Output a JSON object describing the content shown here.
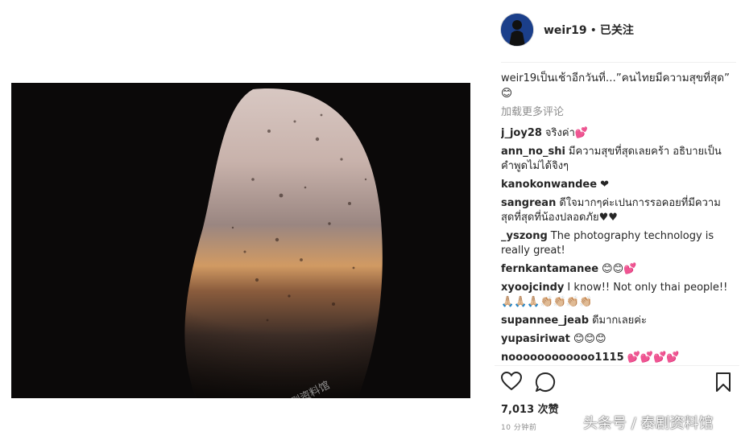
{
  "post": {
    "header": {
      "username": "weir19",
      "separator": "•",
      "follow_status": "已关注"
    },
    "caption": {
      "username": "weir19",
      "text": "เป็นเช้าอีกวันที่...”คนไทยมีความสุขที่สุด” 😊"
    },
    "load_more_label": "加载更多评论",
    "comments": [
      {
        "user": "j_joy28",
        "text": "จริงค่า💕"
      },
      {
        "user": "ann_no_shi",
        "text": "มีความสุขที่สุดเลยคร้า อธิบายเป็นคำพูดไม่ได้จิงๆ"
      },
      {
        "user": "kanokonwandee",
        "text": "❤"
      },
      {
        "user": "sangrean",
        "text": "ดีใจมากๆค่ะเปนการรอคอยที่มีความสุดที่สุดที่น้องปลอดภัย♥♥"
      },
      {
        "user": "_yszong",
        "text": "The photography technology is really great!"
      },
      {
        "user": "fernkantamanee",
        "text": "😊😊💕"
      },
      {
        "user": "xyoojcindy",
        "text": "I know!! Not only thai people!! 🙏🏼🙏🏼🙏🏼👏🏼👏🏼👏🏼👏🏼"
      },
      {
        "user": "supannee_jeab",
        "text": "ดีมากเลยค่ะ"
      },
      {
        "user": "yupasiriwat",
        "text": "😊😊😊"
      },
      {
        "user": "noooooooooooo1115",
        "text": "💕💕💕💕"
      }
    ],
    "likes": "7,013 次赞",
    "time": "10 分钟前",
    "icons": {
      "like": "heart-outline-icon",
      "comment": "speech-bubble-icon",
      "save": "bookmark-icon"
    }
  },
  "watermarks": {
    "photo": "微信公众号@泰剧资料馆",
    "corner": "头条号 / 泰剧资料馆"
  }
}
